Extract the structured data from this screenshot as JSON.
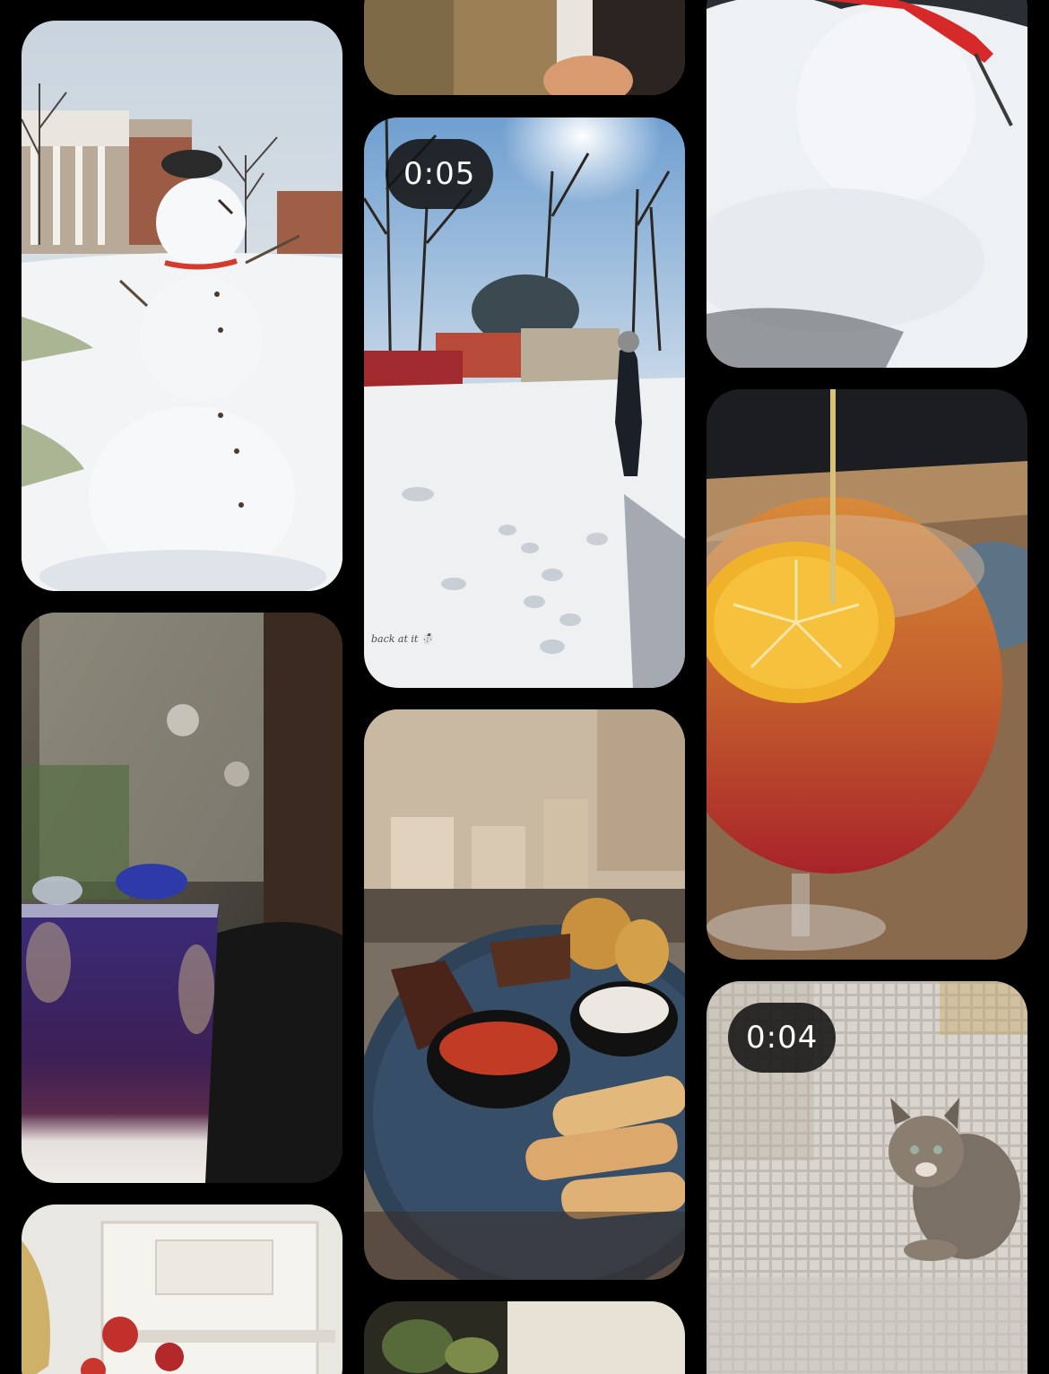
{
  "feed": {
    "tiles": [
      {
        "id": "snowman-campus",
        "kind": "photo",
        "subject": "snowman on snowy campus lawn"
      },
      {
        "id": "butterfly-pea-drink",
        "kind": "photo",
        "subject": "purple layered drink by window"
      },
      {
        "id": "ornate-ceiling",
        "kind": "photo",
        "subject": "ornate ceiling with red flowers"
      },
      {
        "id": "coffee-cup-top",
        "kind": "photo",
        "subject": "hand holding cup"
      },
      {
        "id": "snow-walk-video",
        "kind": "video",
        "duration": "0:05",
        "caption": "back at it ☃️",
        "subject": "person walking through snow"
      },
      {
        "id": "appetizer-platter",
        "kind": "photo",
        "subject": "platter with spring rolls and sauces"
      },
      {
        "id": "plant-bottom",
        "kind": "photo",
        "subject": "plant leaves"
      },
      {
        "id": "snowman-head",
        "kind": "photo",
        "subject": "snowman with red scarf"
      },
      {
        "id": "orange-cocktail",
        "kind": "photo",
        "subject": "cocktail with orange slice"
      },
      {
        "id": "cat-video",
        "kind": "video",
        "duration": "0:04",
        "subject": "tabby cat behind screen"
      }
    ]
  },
  "colors": {
    "background": "#000000",
    "badge_bg": "#141414",
    "badge_text": "#ffffff"
  }
}
